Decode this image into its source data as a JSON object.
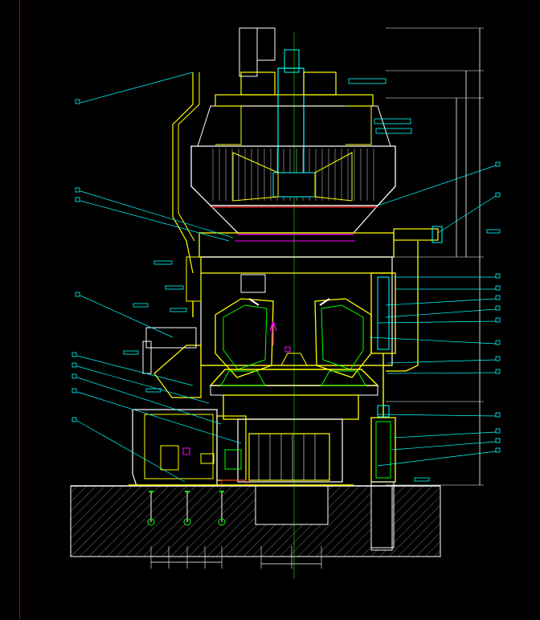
{
  "app": {
    "title": ""
  },
  "colors": {
    "background": "#000000",
    "border": "#b00000",
    "yellow": "#ffff00",
    "cyan": "#00ffff",
    "green": "#00ff00",
    "white": "#ffffff",
    "magenta": "#ff00ff",
    "red": "#ff2020",
    "blue": "#3050ff",
    "gray": "#9a9a9a"
  },
  "drawing": {
    "type": "vertical roller mill section",
    "left_callouts": 9,
    "right_callouts": 19,
    "dimension_labels": "unreadable"
  }
}
